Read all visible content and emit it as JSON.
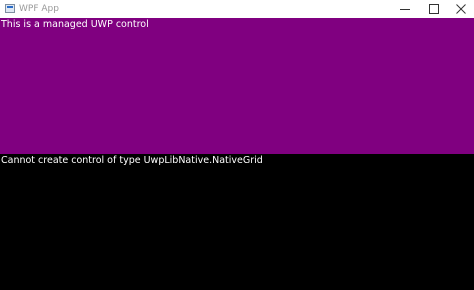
{
  "window": {
    "title": "WPF App"
  },
  "uwp_panel": {
    "text": "This is a managed UWP control",
    "background": "#800080"
  },
  "native_panel": {
    "text": "Cannot create control of type UwpLibNative.NativeGrid",
    "background": "#000000"
  },
  "icons": {
    "app": "app-window-icon",
    "minimize": "minimize-icon",
    "maximize": "maximize-icon",
    "close": "close-icon"
  }
}
